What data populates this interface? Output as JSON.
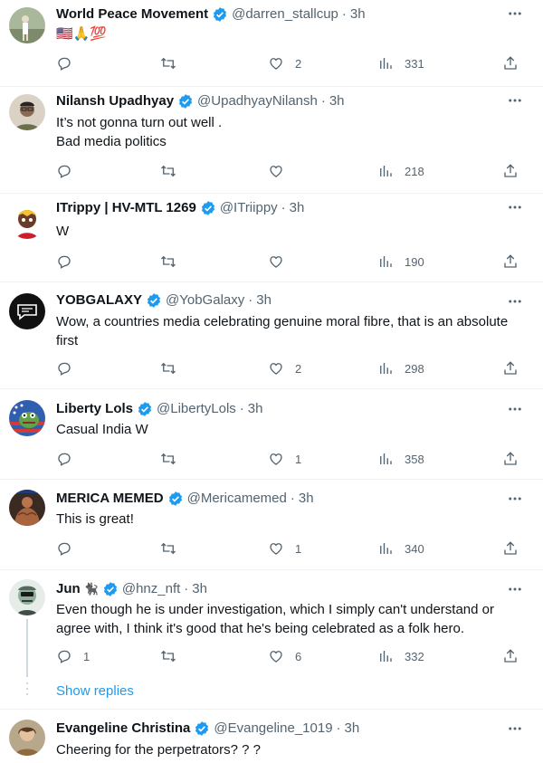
{
  "colors": {
    "verified": "#1d9bf0",
    "muted": "#536471",
    "text": "#0f1419",
    "link": "#1d9bf0"
  },
  "tweets": [
    {
      "name": "World Peace Movement",
      "handle": "@darren_stallcup",
      "time": "3h",
      "text": "🇺🇸🙏💯",
      "replies": "",
      "retweets": "",
      "likes": "2",
      "views": "331",
      "avatar_icon": "person-outdoor-avatar"
    },
    {
      "name": "Nilansh Upadhyay",
      "handle": "@UpadhyayNilansh",
      "time": "3h",
      "text": "It’s not gonna turn out well .\nBad media politics",
      "replies": "",
      "retweets": "",
      "likes": "",
      "views": "218",
      "avatar_icon": "person-glasses-avatar"
    },
    {
      "name": "ITrippy | HV-MTL 1269",
      "handle": "@ITriippy",
      "time": "3h",
      "text": "W",
      "replies": "",
      "retweets": "",
      "likes": "",
      "views": "190",
      "avatar_icon": "cartoon-character-avatar"
    },
    {
      "name": "YOBGALAXY",
      "handle": "@YobGalaxy",
      "time": "3h",
      "text": "Wow, a countries media celebrating genuine moral fibre, that is an absolute first",
      "replies": "",
      "retweets": "",
      "likes": "2",
      "views": "298",
      "avatar_icon": "chat-bubble-logo-avatar"
    },
    {
      "name": "Liberty Lols",
      "handle": "@LibertyLols",
      "time": "3h",
      "text": "Casual India W",
      "replies": "",
      "retweets": "",
      "likes": "1",
      "views": "358",
      "avatar_icon": "frog-flag-avatar"
    },
    {
      "name": "MERICA MEMED",
      "handle": "@Mericamemed",
      "time": "3h",
      "text": "This is great!",
      "replies": "",
      "retweets": "",
      "likes": "1",
      "views": "340",
      "avatar_icon": "muscle-man-avatar"
    },
    {
      "name": "Jun",
      "name_emoji": "🐈‍⬛",
      "handle": "@hnz_nft",
      "time": "3h",
      "text": "Even though he is under investigation, which I simply can't understand or agree with, I think it's good that he's being celebrated as a folk hero.",
      "replies": "1",
      "retweets": "",
      "likes": "6",
      "views": "332",
      "avatar_icon": "zombie-face-avatar"
    },
    {
      "name": "Evangeline Christina",
      "handle": "@Evangeline_1019",
      "time": "3h",
      "text": "Cheering for the perpetrators? ? ?",
      "replies": "",
      "retweets": "",
      "likes": "",
      "views": "",
      "avatar_icon": "person-portrait-avatar"
    }
  ],
  "show_replies_label": "Show replies"
}
